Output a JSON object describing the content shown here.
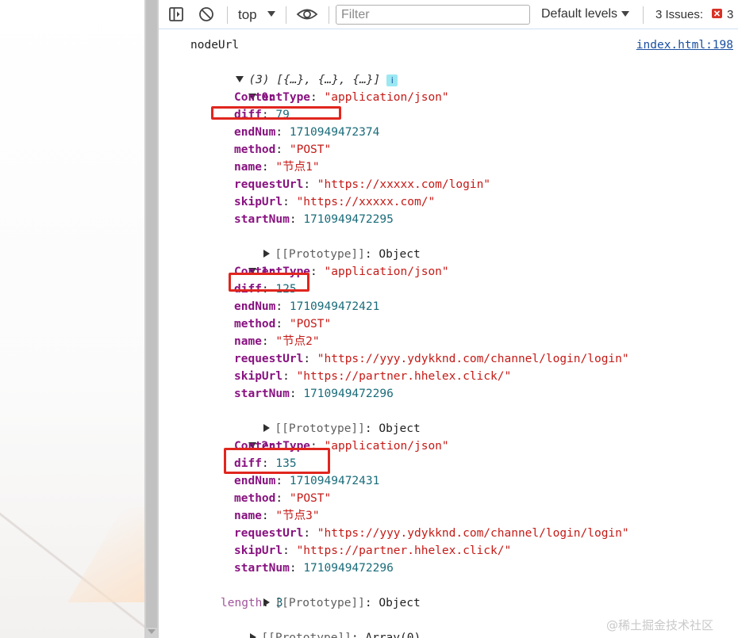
{
  "toolbar": {
    "context": "top",
    "filter_placeholder": "Filter",
    "levels": "Default levels",
    "issues_label": "3 Issues:",
    "issues_count": "3"
  },
  "console": {
    "label": "nodeUrl",
    "source": "index.html:198",
    "summary": "(3) [{…}, {…}, {…}]",
    "items": [
      {
        "index": "0:",
        "ContentType": "\"application/json\"",
        "diff": "79",
        "endNum": "1710949472374",
        "method": "\"POST\"",
        "name": "\"节点1\"",
        "requestUrl": "\"https://xxxxx.com/login\"",
        "skipUrl": "\"https://xxxxx.com/\"",
        "startNum": "1710949472295"
      },
      {
        "index": "1:",
        "ContentType": "\"application/json\"",
        "diff": "125",
        "endNum": "1710949472421",
        "method": "\"POST\"",
        "name": "\"节点2\"",
        "requestUrl": "\"https://yyy.ydykknd.com/channel/login/login\"",
        "skipUrl": "\"https://partner.hhelex.click/\"",
        "startNum": "1710949472296"
      },
      {
        "index": "2:",
        "ContentType": "\"application/json\"",
        "diff": "135",
        "endNum": "1710949472431",
        "method": "\"POST\"",
        "name": "\"节点3\"",
        "requestUrl": "\"https://yyy.ydykknd.com/channel/login/login\"",
        "skipUrl": "\"https://partner.hhelex.click/\"",
        "startNum": "1710949472296"
      }
    ],
    "proto_key": "[[Prototype]]",
    "proto_object": "Object",
    "length_key": "length",
    "length_value": "3",
    "proto_array": "Array(0)"
  },
  "watermark": "@稀土掘金技术社区",
  "highlight_color": "#e0261e"
}
